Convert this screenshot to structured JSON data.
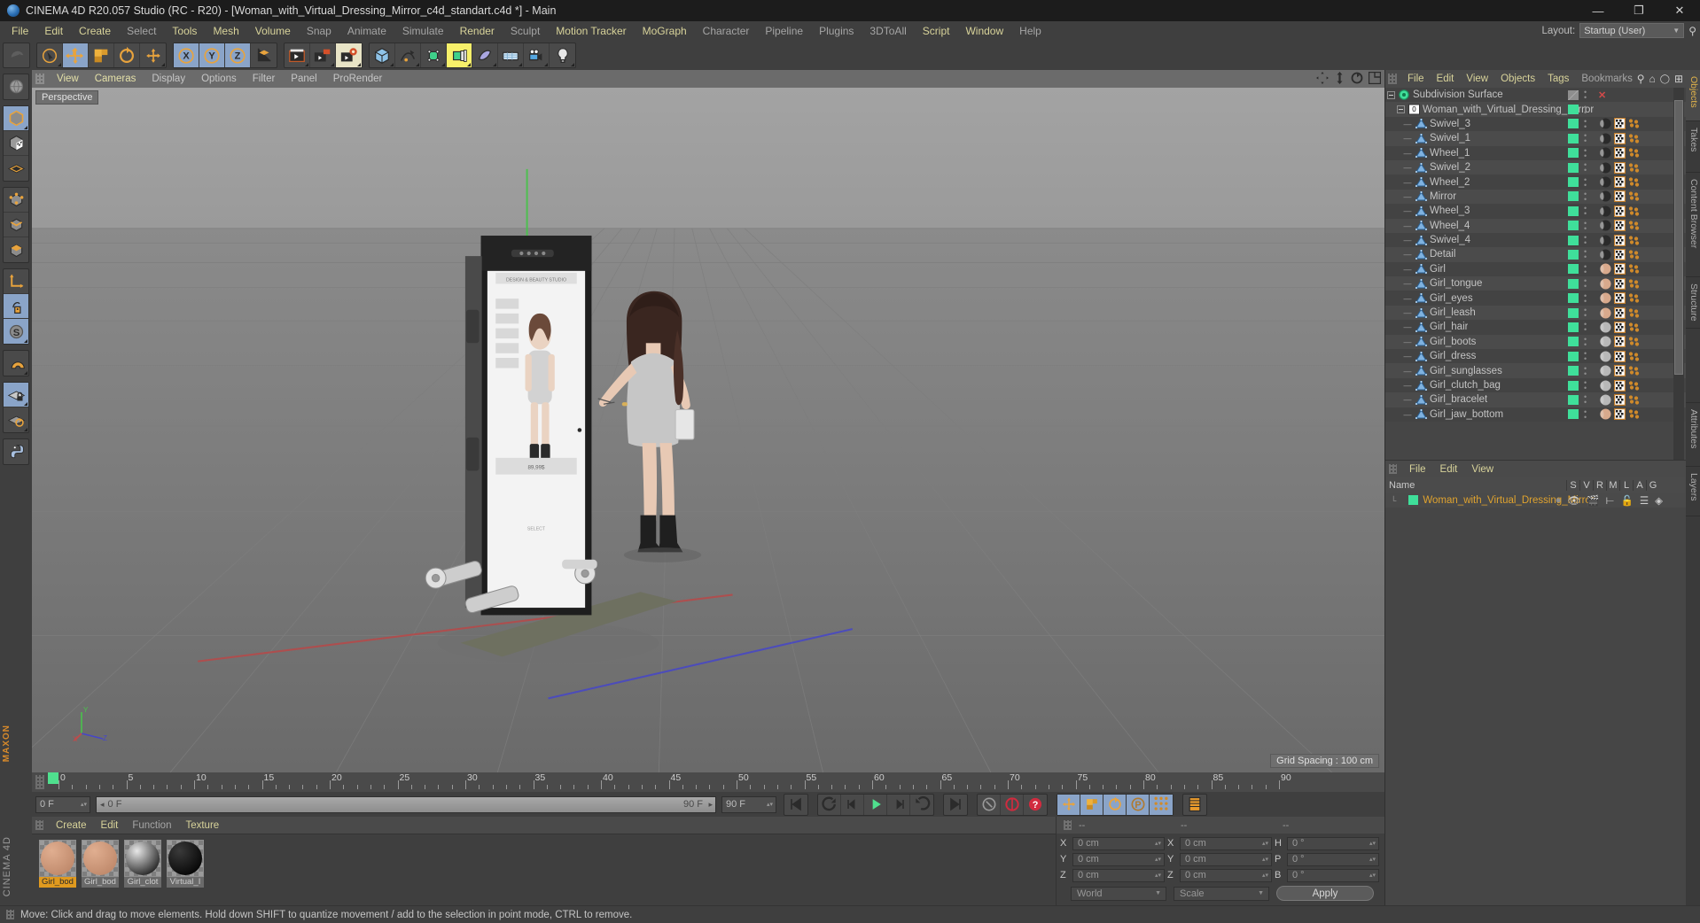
{
  "window": {
    "title": "CINEMA 4D R20.057 Studio (RC - R20) - [Woman_with_Virtual_Dressing_Mirror_c4d_standart.c4d *] - Main",
    "minimize": "—",
    "maximize": "❐",
    "close": "✕"
  },
  "menubar": {
    "items": [
      {
        "label": "File",
        "state": "hi"
      },
      {
        "label": "Edit",
        "state": "hi"
      },
      {
        "label": "Create",
        "state": "hi"
      },
      {
        "label": "Select",
        "state": "lo"
      },
      {
        "label": "Tools",
        "state": "hi"
      },
      {
        "label": "Mesh",
        "state": "hi"
      },
      {
        "label": "Volume",
        "state": "hi"
      },
      {
        "label": "Snap",
        "state": "lo"
      },
      {
        "label": "Animate",
        "state": "lo"
      },
      {
        "label": "Simulate",
        "state": "lo"
      },
      {
        "label": "Render",
        "state": "hi"
      },
      {
        "label": "Sculpt",
        "state": "lo"
      },
      {
        "label": "Motion Tracker",
        "state": "hi"
      },
      {
        "label": "MoGraph",
        "state": "hi"
      },
      {
        "label": "Character",
        "state": "lo"
      },
      {
        "label": "Pipeline",
        "state": "lo"
      },
      {
        "label": "Plugins",
        "state": "lo"
      },
      {
        "label": "3DToAll",
        "state": "lo"
      },
      {
        "label": "Script",
        "state": "hi"
      },
      {
        "label": "Window",
        "state": "hi"
      },
      {
        "label": "Help",
        "state": "lo"
      }
    ],
    "layout_label": "Layout:",
    "layout_value": "Startup (User)"
  },
  "toolbar": {
    "groups": [
      {
        "buttons": [
          {
            "name": "undo-redo-icon",
            "state": "dim"
          }
        ]
      },
      {
        "buttons": [
          {
            "name": "live-selection-icon",
            "state": "off"
          },
          {
            "name": "move-tool-icon",
            "state": "on"
          },
          {
            "name": "scale-tool-icon",
            "state": "off"
          },
          {
            "name": "rotate-tool-icon",
            "state": "off"
          },
          {
            "name": "move-alt-icon",
            "state": "off"
          }
        ]
      },
      {
        "buttons": [
          {
            "name": "axis-x-icon",
            "state": "on"
          },
          {
            "name": "axis-y-icon",
            "state": "on"
          },
          {
            "name": "axis-z-icon",
            "state": "on"
          },
          {
            "name": "world-object-axis-icon",
            "state": "off"
          }
        ]
      },
      {
        "buttons": [
          {
            "name": "render-view-icon",
            "state": "off"
          },
          {
            "name": "render-region-icon",
            "state": "off"
          },
          {
            "name": "render-settings-icon",
            "state": "cream"
          }
        ]
      },
      {
        "buttons": [
          {
            "name": "add-cube-icon",
            "state": "off"
          },
          {
            "name": "add-spline-icon",
            "state": "off"
          },
          {
            "name": "nurbs-generator-icon",
            "state": "off"
          },
          {
            "name": "array-modeling-icon",
            "state": "yellow"
          },
          {
            "name": "deformer-icon",
            "state": "off"
          },
          {
            "name": "scene-environment-icon",
            "state": "off"
          },
          {
            "name": "camera-icon",
            "state": "off"
          },
          {
            "name": "light-icon",
            "state": "off"
          }
        ]
      }
    ]
  },
  "left_toolbar": {
    "buttons": [
      {
        "name": "viewport-globe-icon",
        "state": "off"
      },
      {
        "name": "model-mode-icon",
        "state": "on"
      },
      {
        "name": "texture-mode-icon",
        "state": "off"
      },
      {
        "name": "workplane-mode-icon",
        "state": "off"
      },
      {
        "name": "points-mode-icon",
        "state": "off"
      },
      {
        "name": "edges-mode-icon",
        "state": "off"
      },
      {
        "name": "polygons-mode-icon",
        "state": "off"
      },
      {
        "name": "object-axis-icon",
        "state": "off"
      },
      {
        "name": "enable-axis-icon",
        "state": "on"
      },
      {
        "name": "soft-selection-icon",
        "state": "on"
      },
      {
        "name": "magnet-icon",
        "state": "off"
      },
      {
        "name": "workplane-lock-icon",
        "state": "on"
      },
      {
        "name": "workplane-rotate-icon",
        "state": "off"
      },
      {
        "name": "python-icon",
        "state": "off"
      }
    ],
    "brand_top": "MAXON",
    "brand_bottom": "CINEMA 4D"
  },
  "viewport": {
    "menu": [
      {
        "label": "View",
        "state": "hi"
      },
      {
        "label": "Cameras",
        "state": "hi"
      },
      {
        "label": "Display",
        "state": "lo"
      },
      {
        "label": "Options",
        "state": "lo"
      },
      {
        "label": "Filter",
        "state": "lo"
      },
      {
        "label": "Panel",
        "state": "lo"
      },
      {
        "label": "ProRender",
        "state": "lo"
      }
    ],
    "perspective_label": "Perspective",
    "grid_spacing": "Grid Spacing : 100 cm",
    "axis_labels": {
      "x": "X",
      "y": "Y",
      "z": "Z"
    },
    "mirror_screen": {
      "brand": "DESIGN & BEAUTY STUDIO",
      "price": "89,99$",
      "caption": "SELECT"
    }
  },
  "timeline": {
    "ticks": [
      0,
      5,
      10,
      15,
      20,
      25,
      30,
      35,
      40,
      45,
      50,
      55,
      60,
      65,
      70,
      75,
      80,
      85,
      90
    ],
    "current_frame": "0 F",
    "start_field": "0 F",
    "playhead_label": "0 F",
    "end_field_right": "90 F",
    "end_field": "90 F",
    "transport": [
      {
        "name": "go-to-start-icon"
      },
      {
        "name": "previous-key-icon"
      },
      {
        "name": "previous-frame-icon"
      },
      {
        "name": "play-icon"
      },
      {
        "name": "next-frame-icon"
      },
      {
        "name": "next-key-icon"
      },
      {
        "name": "go-to-end-icon"
      },
      {
        "name": "loop-playback-icon"
      },
      {
        "name": "record-active-objects-icon"
      },
      {
        "name": "autokeying-icon"
      },
      {
        "name": "key-position-icon"
      },
      {
        "name": "key-scale-icon"
      },
      {
        "name": "key-rotation-icon"
      },
      {
        "name": "key-parameter-icon"
      },
      {
        "name": "key-point-level-icon"
      },
      {
        "name": "timeline-toggle-icon"
      }
    ]
  },
  "material_manager": {
    "menu": [
      {
        "label": "Create",
        "state": "hi"
      },
      {
        "label": "Edit",
        "state": "hi"
      },
      {
        "label": "Function",
        "state": "lo"
      },
      {
        "label": "Texture",
        "state": "hi"
      }
    ],
    "materials": [
      {
        "name": "Girl_bod",
        "selected": true,
        "color1": "#e0ae90",
        "color2": "#c08a6c"
      },
      {
        "name": "Girl_bod",
        "selected": false,
        "color1": "#e0ae90",
        "color2": "#c08a6c"
      },
      {
        "name": "Girl_clot",
        "selected": false,
        "color1": "#e8e8e8",
        "color2": "#2a2a2a"
      },
      {
        "name": "Virtual_I",
        "selected": false,
        "color1": "#3a3a3a",
        "color2": "#070707"
      }
    ]
  },
  "coordinates": {
    "header": [
      "--",
      "--",
      "--"
    ],
    "rows": [
      {
        "pos_label": "X",
        "pos_value": "0 cm",
        "size_label": "X",
        "size_value": "0 cm",
        "rot_label": "H",
        "rot_value": "0 °"
      },
      {
        "pos_label": "Y",
        "pos_value": "0 cm",
        "size_label": "Y",
        "size_value": "0 cm",
        "rot_label": "P",
        "rot_value": "0 °"
      },
      {
        "pos_label": "Z",
        "pos_value": "0 cm",
        "size_label": "Z",
        "size_value": "0 cm",
        "rot_label": "B",
        "rot_value": "0 °"
      }
    ],
    "system": "World",
    "mode": "Scale",
    "apply": "Apply"
  },
  "object_manager": {
    "menu": [
      {
        "label": "File",
        "state": "hi"
      },
      {
        "label": "Edit",
        "state": "hi"
      },
      {
        "label": "View",
        "state": "hi"
      },
      {
        "label": "Objects",
        "state": "hi"
      },
      {
        "label": "Tags",
        "state": "hi"
      },
      {
        "label": "Bookmarks",
        "state": "lo"
      }
    ],
    "rows": [
      {
        "name": "Subdivision Surface",
        "type": "generator",
        "depth": 0,
        "tags": [
          "none"
        ],
        "close": true
      },
      {
        "name": "Woman_with_Virtual_Dressing_Mirror",
        "type": "null",
        "depth": 1,
        "tags": []
      },
      {
        "name": "Swivel_3",
        "type": "polygon",
        "depth": 2,
        "tags": [
          "mat-dark",
          "uv",
          "sel"
        ]
      },
      {
        "name": "Swivel_1",
        "type": "polygon",
        "depth": 2,
        "tags": [
          "mat-dark",
          "uv",
          "sel"
        ]
      },
      {
        "name": "Wheel_1",
        "type": "polygon",
        "depth": 2,
        "tags": [
          "mat-dark",
          "uv",
          "sel"
        ]
      },
      {
        "name": "Swivel_2",
        "type": "polygon",
        "depth": 2,
        "tags": [
          "mat-dark",
          "uv",
          "sel"
        ]
      },
      {
        "name": "Wheel_2",
        "type": "polygon",
        "depth": 2,
        "tags": [
          "mat-dark",
          "uv",
          "sel"
        ]
      },
      {
        "name": "Mirror",
        "type": "polygon",
        "depth": 2,
        "tags": [
          "mat-dark",
          "uv",
          "sel"
        ]
      },
      {
        "name": "Wheel_3",
        "type": "polygon",
        "depth": 2,
        "tags": [
          "mat-dark",
          "uv",
          "sel"
        ]
      },
      {
        "name": "Wheel_4",
        "type": "polygon",
        "depth": 2,
        "tags": [
          "mat-dark",
          "uv",
          "sel"
        ]
      },
      {
        "name": "Swivel_4",
        "type": "polygon",
        "depth": 2,
        "tags": [
          "mat-dark",
          "uv",
          "sel"
        ]
      },
      {
        "name": "Detail",
        "type": "polygon",
        "depth": 2,
        "tags": [
          "mat-dark",
          "uv",
          "sel"
        ]
      },
      {
        "name": "Girl",
        "type": "polygon",
        "depth": 2,
        "tags": [
          "mat-skin",
          "uv",
          "sel"
        ]
      },
      {
        "name": "Girl_tongue",
        "type": "polygon",
        "depth": 2,
        "tags": [
          "mat-skin",
          "uv",
          "sel"
        ]
      },
      {
        "name": "Girl_eyes",
        "type": "polygon",
        "depth": 2,
        "tags": [
          "mat-skin",
          "uv",
          "sel"
        ]
      },
      {
        "name": "Girl_leash",
        "type": "polygon",
        "depth": 2,
        "tags": [
          "mat-skin",
          "uv",
          "sel"
        ]
      },
      {
        "name": "Girl_hair",
        "type": "polygon",
        "depth": 2,
        "tags": [
          "mat-cloth",
          "uv",
          "sel"
        ]
      },
      {
        "name": "Girl_boots",
        "type": "polygon",
        "depth": 2,
        "tags": [
          "mat-cloth",
          "uv",
          "sel"
        ]
      },
      {
        "name": "Girl_dress",
        "type": "polygon",
        "depth": 2,
        "tags": [
          "mat-cloth",
          "uv",
          "sel"
        ]
      },
      {
        "name": "Girl_sunglasses",
        "type": "polygon",
        "depth": 2,
        "tags": [
          "mat-cloth",
          "uv",
          "sel"
        ]
      },
      {
        "name": "Girl_clutch_bag",
        "type": "polygon",
        "depth": 2,
        "tags": [
          "mat-cloth",
          "uv",
          "sel"
        ]
      },
      {
        "name": "Girl_bracelet",
        "type": "polygon",
        "depth": 2,
        "tags": [
          "mat-cloth",
          "uv",
          "sel"
        ]
      },
      {
        "name": "Girl_jaw_bottom",
        "type": "polygon",
        "depth": 2,
        "tags": [
          "mat-skin",
          "uv",
          "sel"
        ]
      }
    ]
  },
  "layer_manager": {
    "menu": [
      {
        "label": "File",
        "state": "hi"
      },
      {
        "label": "Edit",
        "state": "hi"
      },
      {
        "label": "View",
        "state": "hi"
      }
    ],
    "name_col": "Name",
    "columns": [
      "S",
      "V",
      "R",
      "M",
      "L",
      "A",
      "G"
    ],
    "rows": [
      {
        "name": "Woman_with_Virtual_Dressing_Mirror",
        "color": "#3fdf9a"
      }
    ]
  },
  "right_tabs": [
    {
      "label": "Objects",
      "active": true
    },
    {
      "label": "Takes",
      "active": false
    },
    {
      "label": "Content Browser",
      "active": false
    },
    {
      "label": "Structure",
      "active": false
    }
  ],
  "right_tabs_lower": [
    {
      "label": "Attributes",
      "active": false
    },
    {
      "label": "Layers",
      "active": false
    }
  ],
  "statusbar": {
    "text": "Move: Click and drag to move elements. Hold down SHIFT to quantize movement / add to the selection in point mode, CTRL to remove."
  },
  "colors": {
    "accent_green": "#3fdf9a",
    "accent_orange": "#e0a32e",
    "menu_highlight": "#d8d39a",
    "panel_bg": "#3f3f3f",
    "viewport_sky": "#9a9a9a"
  }
}
